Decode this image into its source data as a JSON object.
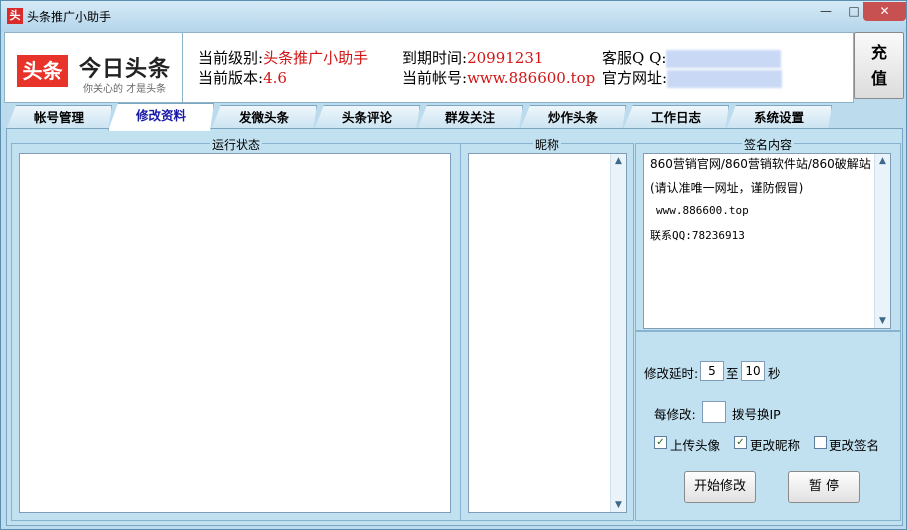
{
  "window": {
    "title": "头条推广小助手",
    "icon": "头",
    "minimize": "—",
    "maximize": "□",
    "close": "✕"
  },
  "logo": {
    "mark": "头条",
    "name": "今日头条",
    "slogan": "你关心的 才是头条"
  },
  "info": {
    "level_label": "当前级别:",
    "level_value": "头条推广小助手",
    "version_label": "当前版本:",
    "version_value": "4.6",
    "expire_label": "到期时间:",
    "expire_value": "20991231",
    "account_label": "当前帐号:",
    "account_value": "www.886600.top",
    "qq_label": "客服Q Q:",
    "site_label": "官方网址:"
  },
  "recharge": {
    "line1": "充",
    "line2": "值"
  },
  "tabs": [
    "帐号管理",
    "修改资料",
    "发微头条",
    "头条评论",
    "群发关注",
    "炒作头条",
    "工作日志",
    "系统设置"
  ],
  "groups": {
    "status_title": "运行状态",
    "nickname_title": "昵称",
    "signature_title": "签名内容"
  },
  "signature_lines": [
    "860营销官网/860营销软件站/860破解站",
    "(请认准唯一网址，谨防假冒)",
    "www.886600.top",
    "联系QQ:78236913"
  ],
  "settings": {
    "delay_label": "修改延时:",
    "delay_from": "5",
    "delay_to_label": "至",
    "delay_to": "10",
    "delay_unit": "秒",
    "every_label": "每修改:",
    "every_value": "",
    "every_suffix": "拨号换IP",
    "upload_avatar": "上传头像",
    "change_nick": "更改昵称",
    "change_sign": "更改签名",
    "start_button": "开始修改",
    "pause_button": "暂 停"
  }
}
